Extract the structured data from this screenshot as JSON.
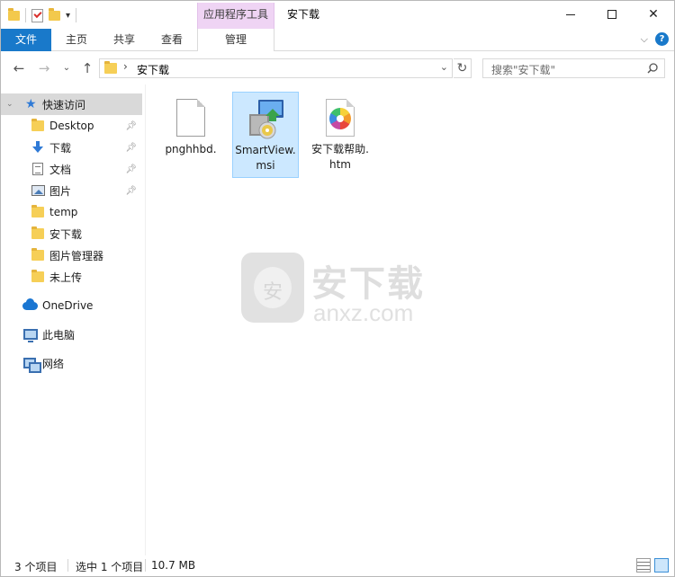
{
  "window": {
    "title": "安下载",
    "context_tab_header": "应用程序工具"
  },
  "ribbon": {
    "file_tab": "文件",
    "tabs": [
      "主页",
      "共享",
      "查看"
    ],
    "manage_tab": "管理"
  },
  "address": {
    "path": "安下载",
    "search_placeholder": "搜索\"安下载\""
  },
  "nav": {
    "quick_access": "快速访问",
    "items": [
      {
        "label": "Desktop",
        "icon": "folder-icon",
        "pinned": true
      },
      {
        "label": "下载",
        "icon": "download-icon",
        "pinned": true
      },
      {
        "label": "文档",
        "icon": "document-icon",
        "pinned": true
      },
      {
        "label": "图片",
        "icon": "picture-icon",
        "pinned": true
      },
      {
        "label": "temp",
        "icon": "folder-icon",
        "pinned": false
      },
      {
        "label": "安下载",
        "icon": "folder-icon",
        "pinned": false
      },
      {
        "label": "图片管理器",
        "icon": "folder-icon",
        "pinned": false
      },
      {
        "label": "未上传",
        "icon": "folder-icon",
        "pinned": false
      }
    ],
    "onedrive": "OneDrive",
    "this_pc": "此电脑",
    "network": "网络"
  },
  "files": [
    {
      "name": "pnghhbd.",
      "type": "blank",
      "selected": false
    },
    {
      "name": "SmartView.msi",
      "type": "msi",
      "selected": true
    },
    {
      "name": "安下载帮助.htm",
      "type": "htm",
      "selected": false
    }
  ],
  "watermark": {
    "title": "安下载",
    "url": "anxz.com",
    "shield_char": "安"
  },
  "status": {
    "item_count": "3 个项目",
    "selected": "选中 1 个项目",
    "size": "10.7 MB"
  },
  "colors": {
    "accent": "#1979ca",
    "context_tab": "#efd4f4",
    "selection": "#cce8ff"
  }
}
